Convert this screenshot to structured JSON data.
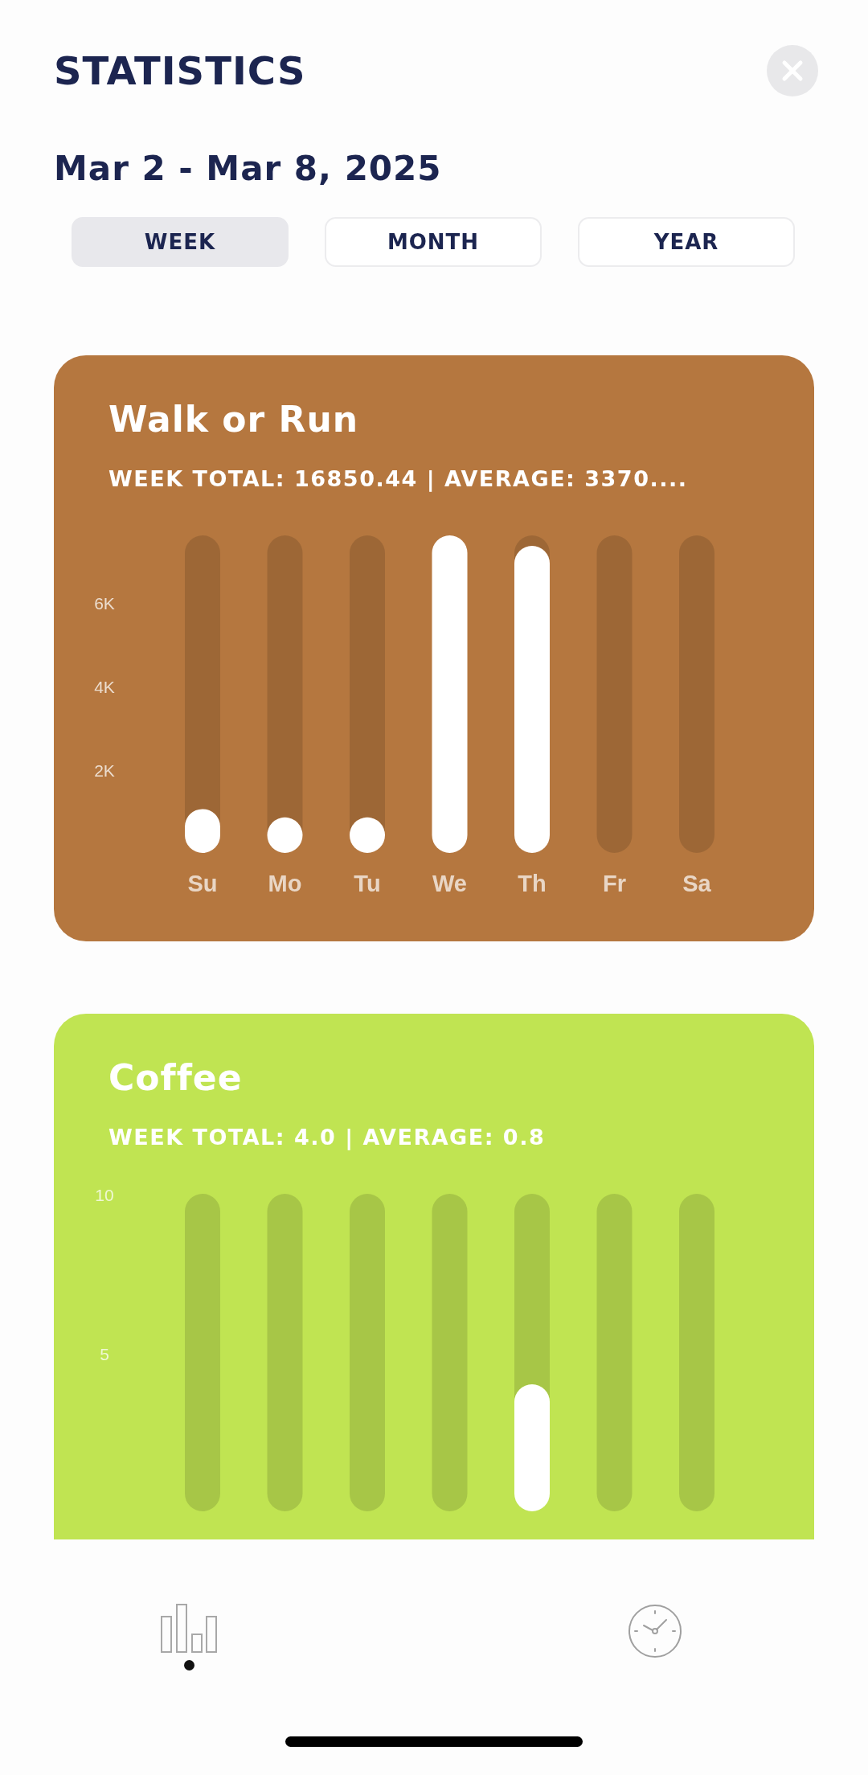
{
  "header": {
    "title": "STATISTICS",
    "date_range": "Mar 2 - Mar 8, 2025"
  },
  "tabs": [
    {
      "label": "WEEK",
      "selected": true
    },
    {
      "label": "MONTH",
      "selected": false
    },
    {
      "label": "YEAR",
      "selected": false
    }
  ],
  "cards": [
    {
      "title": "Walk or Run",
      "summary": "WEEK TOTAL: 16850.44 | AVERAGE: 3370....",
      "color": "#b5773f",
      "chart_data": {
        "type": "bar",
        "categories": [
          "Su",
          "Mo",
          "Tu",
          "We",
          "Th",
          "Fr",
          "Sa"
        ],
        "values": [
          1050,
          850,
          850,
          7600,
          7350,
          0,
          0
        ],
        "ylim": [
          0,
          7600
        ],
        "yticks": [
          {
            "value": 2000,
            "label": "2K"
          },
          {
            "value": 4000,
            "label": "4K"
          },
          {
            "value": 6000,
            "label": "6K"
          }
        ]
      }
    },
    {
      "title": "Coffee",
      "summary": "WEEK TOTAL: 4.0 | AVERAGE: 0.8",
      "color": "#c0e452",
      "chart_data": {
        "type": "bar",
        "values": [
          0,
          0,
          0,
          0,
          4,
          0,
          0
        ],
        "ylim": [
          0,
          10
        ],
        "yticks": [
          5,
          10
        ]
      }
    }
  ],
  "nav": [
    {
      "kind": "chart",
      "selected": true
    },
    {
      "kind": "clock",
      "selected": false
    }
  ]
}
